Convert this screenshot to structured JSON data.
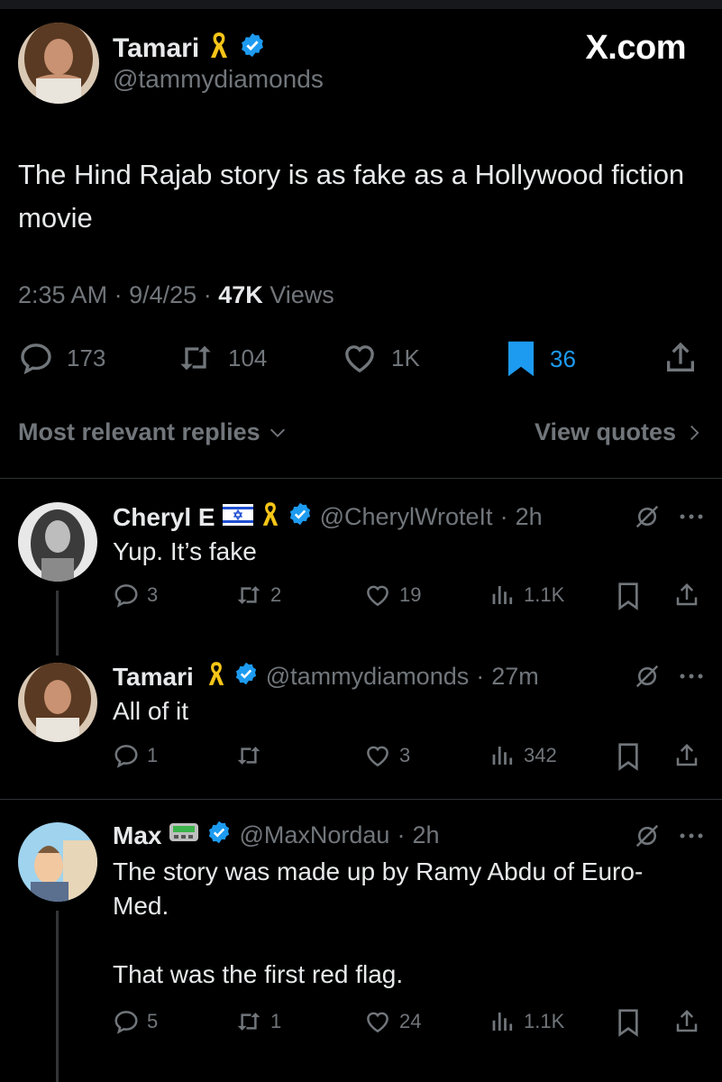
{
  "brand": "X.com",
  "tweet": {
    "author_name": "Tamari",
    "author_handle": "@tammydiamonds",
    "text": "The Hind Rajab story is as fake as a Hollywood fiction movie",
    "time": "2:35 AM",
    "date": "9/4/25",
    "views_count": "47K",
    "views_label": "Views",
    "separator": "·",
    "stats": {
      "replies": "173",
      "reposts": "104",
      "likes": "1K",
      "bookmarks": "36"
    }
  },
  "replies_bar": {
    "sort_label": "Most relevant replies",
    "quotes_label": "View quotes"
  },
  "replies": [
    {
      "name": "Cheryl E",
      "handle": "@CherylWroteIt",
      "time": "2h",
      "text": "Yup. It’s fake",
      "stats": {
        "replies": "3",
        "reposts": "2",
        "likes": "19",
        "views": "1.1K"
      }
    },
    {
      "name": "Tamari",
      "handle": "@tammydiamonds",
      "time": "27m",
      "text": "All of it",
      "stats": {
        "replies": "1",
        "reposts": "",
        "likes": "3",
        "views": "342"
      }
    },
    {
      "name": "Max",
      "handle": "@MaxNordau",
      "time": "2h",
      "text_line1": "The story was made up by Ramy Abdu of Euro-",
      "text_line2": "Med.",
      "text_line3": "That was the first red flag.",
      "stats": {
        "replies": "5",
        "reposts": "1",
        "likes": "24",
        "views": "1.1K"
      }
    }
  ],
  "colors": {
    "accent": "#1d9bf0",
    "text": "#e7e9ea",
    "muted": "#71767b",
    "background": "#000000",
    "divider": "#2f3336",
    "ribbon": "#f5c518"
  }
}
